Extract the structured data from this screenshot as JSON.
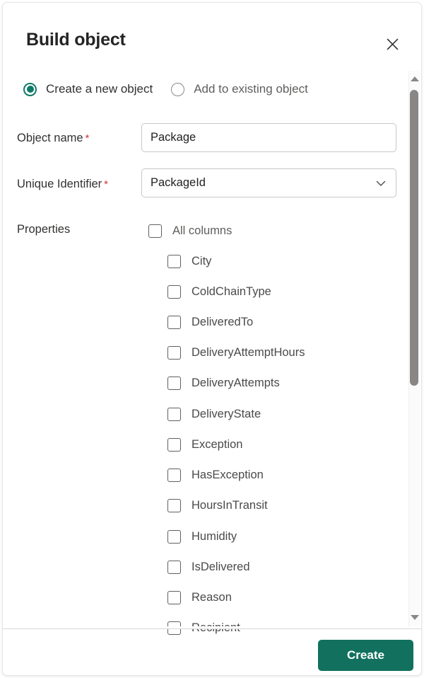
{
  "dialog": {
    "title": "Build object",
    "close_icon": "close-icon"
  },
  "mode": {
    "options": [
      {
        "label": "Create a new object",
        "selected": true
      },
      {
        "label": "Add to existing object",
        "selected": false
      }
    ]
  },
  "form": {
    "object_name": {
      "label": "Object name",
      "required_mark": "*",
      "value": "Package",
      "placeholder": "Object name"
    },
    "unique_identifier": {
      "label": "Unique Identifier",
      "required_mark": "*",
      "value": "PackageId",
      "chevron_icon": "chevron-down-icon"
    },
    "properties": {
      "label": "Properties",
      "all_columns": {
        "label": "All columns",
        "checked": false
      },
      "items": [
        {
          "label": "City",
          "checked": false
        },
        {
          "label": "ColdChainType",
          "checked": false
        },
        {
          "label": "DeliveredTo",
          "checked": false
        },
        {
          "label": "DeliveryAttemptHours",
          "checked": false
        },
        {
          "label": "DeliveryAttempts",
          "checked": false
        },
        {
          "label": "DeliveryState",
          "checked": false
        },
        {
          "label": "Exception",
          "checked": false
        },
        {
          "label": "HasException",
          "checked": false
        },
        {
          "label": "HoursInTransit",
          "checked": false
        },
        {
          "label": "Humidity",
          "checked": false
        },
        {
          "label": "IsDelivered",
          "checked": false
        },
        {
          "label": "Reason",
          "checked": false
        },
        {
          "label": "Recipient",
          "checked": false
        }
      ]
    }
  },
  "scrollbar": {
    "up_arrow_icon": "scroll-up-arrow-icon",
    "down_arrow_icon": "scroll-down-arrow-icon"
  },
  "footer": {
    "create_label": "Create"
  },
  "colors": {
    "accent_green": "#11715E",
    "radio_selected": "#107A68",
    "required_red": "#D13438",
    "title_text": "#242424"
  }
}
